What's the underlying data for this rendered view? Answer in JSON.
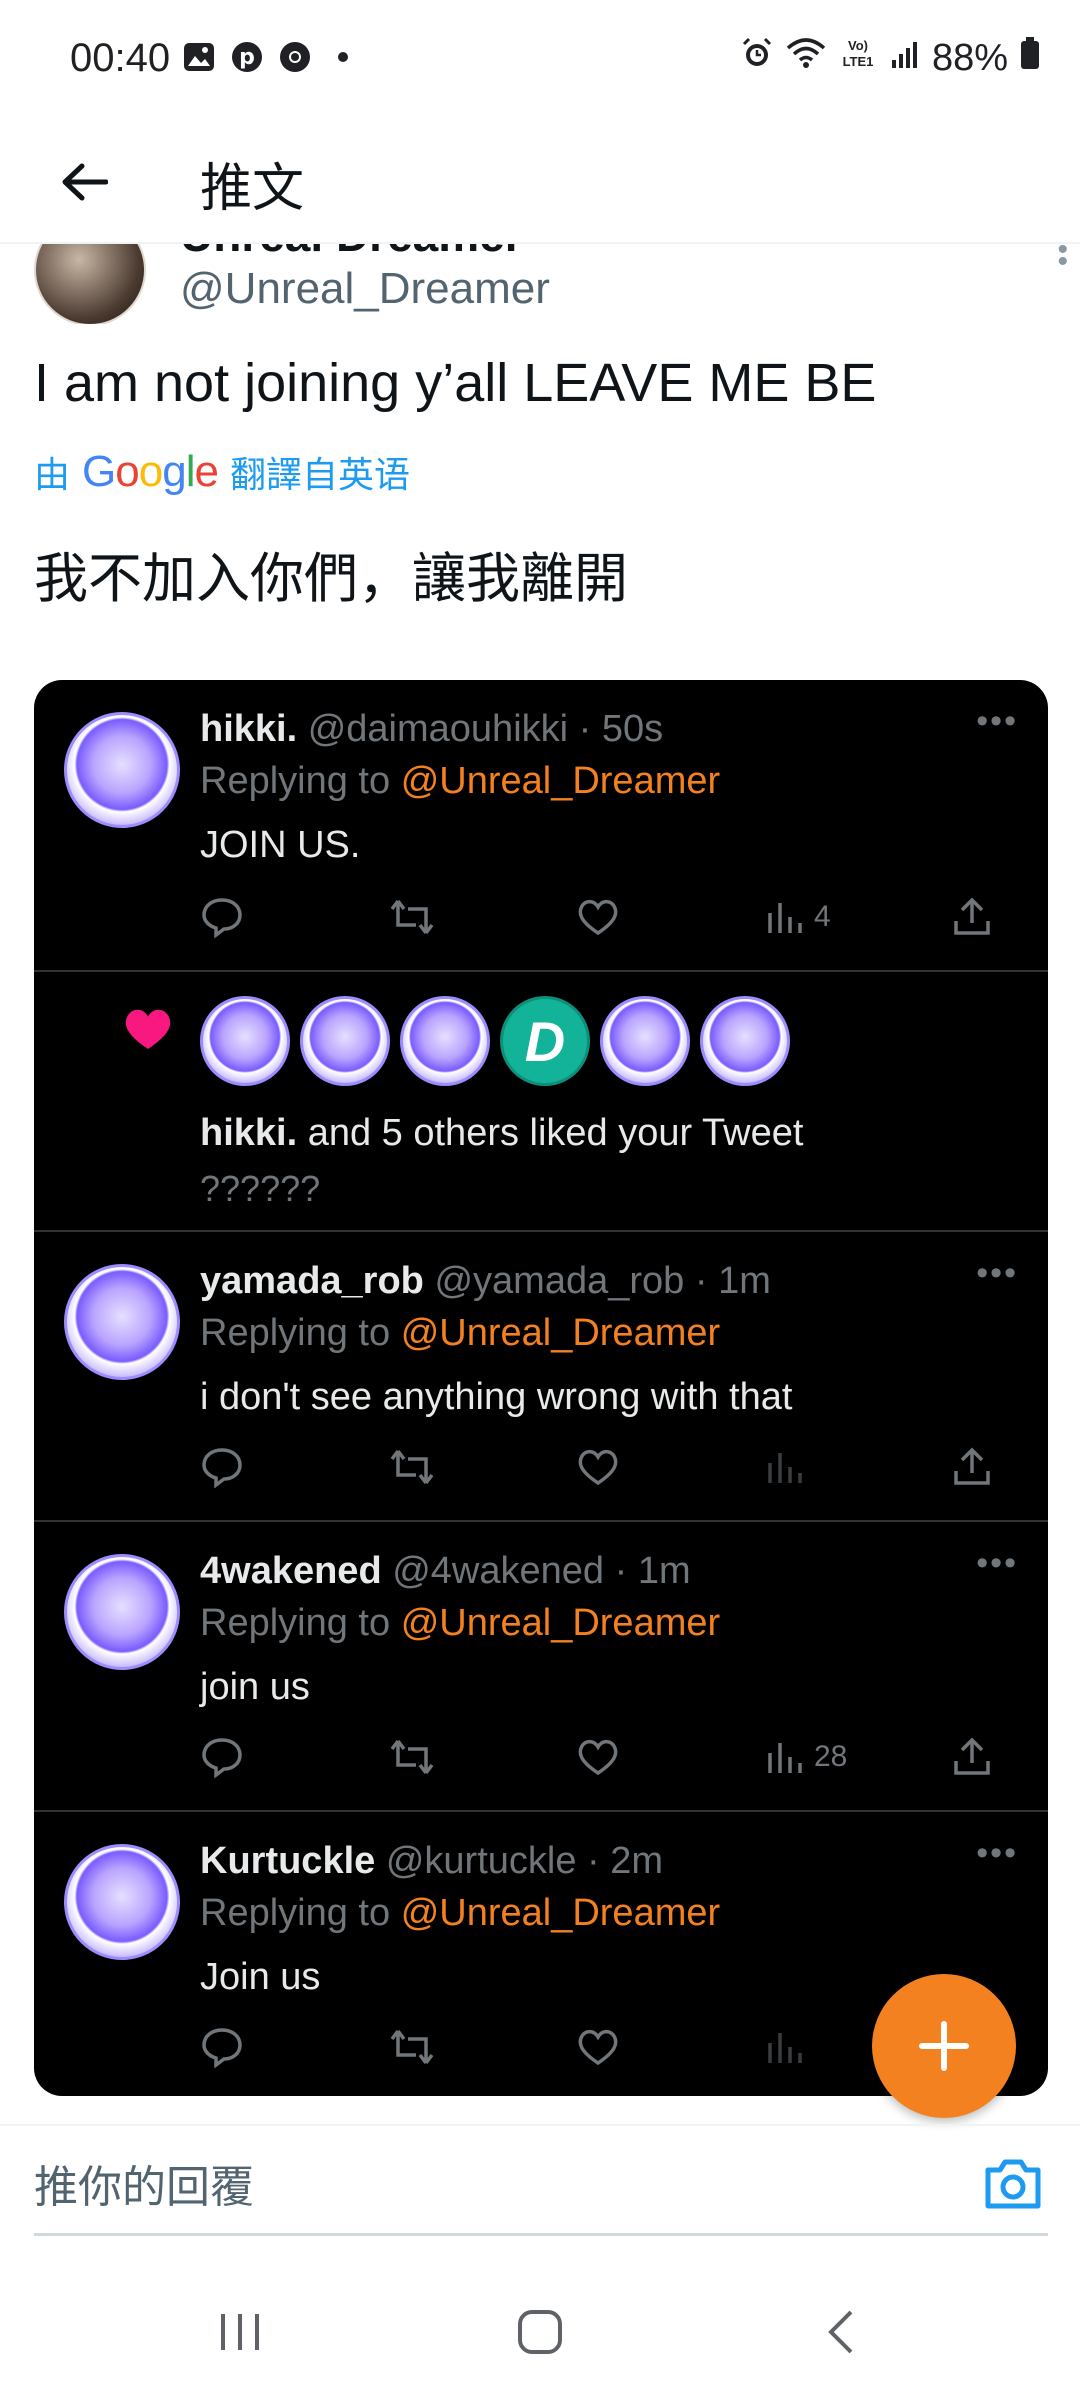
{
  "status_bar": {
    "time": "00:40",
    "battery": "88%",
    "left_icons": [
      "image-icon",
      "pinterest-icon",
      "chrome-icon",
      "dot-icon"
    ],
    "right_icons": [
      "alarm-icon",
      "wifi-icon",
      "volte-icon",
      "signal-icon",
      "battery-icon"
    ]
  },
  "header": {
    "title": "推文"
  },
  "tweet": {
    "author_name": "Unreal Dreamer",
    "author_handle": "@Unreal_Dreamer",
    "text": "I am not joining y’all LEAVE ME BE",
    "translate_prefix": "由",
    "translate_brand": "Google",
    "translate_suffix": "翻譯自英语",
    "translated_text": "我不加入你們，讓我離開"
  },
  "embed": {
    "replies": [
      {
        "name": "hikki.",
        "handle": "@daimaouhikki",
        "time": "50s",
        "replying_prefix": "Replying to",
        "replying_to": "@Unreal_Dreamer",
        "text": "JOIN US.",
        "views": "4"
      },
      {
        "name": "yamada_rob",
        "handle": "@yamada_rob",
        "time": "1m",
        "replying_prefix": "Replying to",
        "replying_to": "@Unreal_Dreamer",
        "text": "i don't see anything wrong with that",
        "views": ""
      },
      {
        "name": "4wakened",
        "handle": "@4wakened",
        "time": "1m",
        "replying_prefix": "Replying to",
        "replying_to": "@Unreal_Dreamer",
        "text": "join us",
        "views": "28"
      },
      {
        "name": "Kurtuckle",
        "handle": "@kurtuckle",
        "time": "2m",
        "replying_prefix": "Replying to",
        "replying_to": "@Unreal_Dreamer",
        "text": "Join us",
        "views": ""
      }
    ],
    "likes": {
      "name": "hikki.",
      "rest": " and 5 others liked your Tweet",
      "sub": "??????",
      "d_badge": "D"
    },
    "more": "•••",
    "fab": "+"
  },
  "reply_bar": {
    "placeholder": "推你的回覆"
  },
  "colors": {
    "accent": "#f4811f",
    "link": "#1d9bf0",
    "heart": "#f91880"
  }
}
